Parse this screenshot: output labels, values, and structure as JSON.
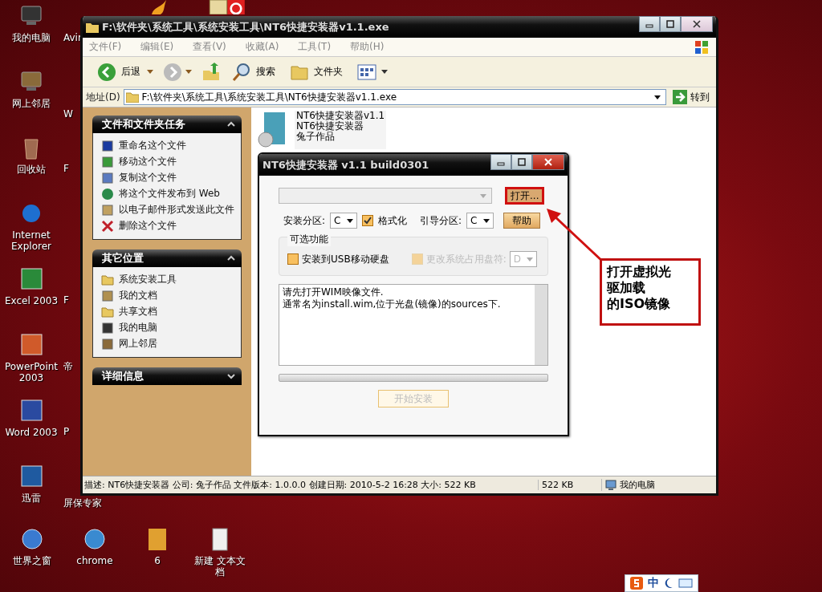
{
  "desktop": {
    "icons": [
      {
        "label": "我的电脑",
        "kind": "computer"
      },
      {
        "label": "网上邻居",
        "kind": "network"
      },
      {
        "label": "回收站",
        "kind": "bin"
      },
      {
        "label": "Internet Explorer",
        "kind": "ie"
      },
      {
        "label": "Excel 2003",
        "kind": "excel"
      },
      {
        "label": "PowerPoint 2003",
        "kind": "ppt"
      },
      {
        "label": "Word 2003",
        "kind": "word"
      },
      {
        "label": "迅雷",
        "kind": "xunlei"
      }
    ],
    "covered_labels": [
      "Avir",
      "W",
      "F",
      "F",
      "帝",
      "P",
      "屏保专家"
    ],
    "bottom_icons": [
      {
        "label": "世界之窗",
        "kind": "globe"
      },
      {
        "label": "chrome",
        "kind": "chrome"
      },
      {
        "label": "6",
        "kind": "jpg"
      },
      {
        "label": "新建 文本文档",
        "kind": "text"
      }
    ]
  },
  "explorer": {
    "title": "F:\\软件夹\\系统工具\\系统安装工具\\NT6快捷安装器v1.1.exe",
    "menu": [
      "文件(F)",
      "编辑(E)",
      "查看(V)",
      "收藏(A)",
      "工具(T)",
      "帮助(H)"
    ],
    "toolbar": {
      "back": "后退",
      "search": "搜索",
      "folders": "文件夹"
    },
    "address": {
      "label": "地址(D)",
      "value": "F:\\软件夹\\系统工具\\系统安装工具\\NT6快捷安装器v1.1.exe",
      "go": "转到"
    },
    "task_panels": [
      {
        "title": "文件和文件夹任务",
        "expanded": true,
        "items": [
          {
            "label": "重命名这个文件",
            "kind": "rename"
          },
          {
            "label": "移动这个文件",
            "kind": "move"
          },
          {
            "label": "复制这个文件",
            "kind": "copy"
          },
          {
            "label": "将这个文件发布到 Web",
            "kind": "web"
          },
          {
            "label": "以电子邮件形式发送此文件",
            "kind": "mail"
          },
          {
            "label": "删除这个文件",
            "kind": "delete"
          }
        ]
      },
      {
        "title": "其它位置",
        "expanded": true,
        "items": [
          {
            "label": "系统安装工具",
            "kind": "folder"
          },
          {
            "label": "我的文档",
            "kind": "docs"
          },
          {
            "label": "共享文档",
            "kind": "folder"
          },
          {
            "label": "我的电脑",
            "kind": "computer"
          },
          {
            "label": "网上邻居",
            "kind": "network"
          }
        ]
      },
      {
        "title": "详细信息",
        "expanded": false
      }
    ],
    "file": {
      "lines": [
        "NT6快捷安装器v1.1",
        "NT6快捷安装器",
        "兔子作品"
      ]
    },
    "status_bar": {
      "description": "描述: NT6快捷安装器 公司: 兔子作品 文件版本: 1.0.0.0 创建日期: 2010-5-2 16:28 大小: 522 KB",
      "size": "522 KB",
      "zone": "我的电脑"
    }
  },
  "dialog": {
    "title": "NT6快捷安装器 v1.1 build0301",
    "open_button": "打开...",
    "install_partition": {
      "label": "安装分区:",
      "value": "C"
    },
    "format": {
      "label": "格式化",
      "checked": true
    },
    "boot_partition": {
      "label": "引导分区:",
      "value": "C"
    },
    "help_button": "帮助",
    "options": {
      "title": "可选功能",
      "usb": {
        "label": "安装到USB移动硬盘",
        "checked": false
      },
      "change_letter": {
        "label": "更改系统占用盘符:",
        "checked": false,
        "disabled": true
      },
      "letter": {
        "value": "D",
        "disabled": true
      }
    },
    "log": "请先打开WIM映像文件.\n通常名为install.wim,位于光盘(镜像)的sources下.",
    "progress": {
      "level": 0
    },
    "start_button": {
      "label": "开始安装",
      "disabled": true
    }
  },
  "callout": {
    "lines": [
      "打开虚拟光",
      "驱加载",
      "的ISO镜像"
    ]
  },
  "ime": {
    "label": "中"
  }
}
